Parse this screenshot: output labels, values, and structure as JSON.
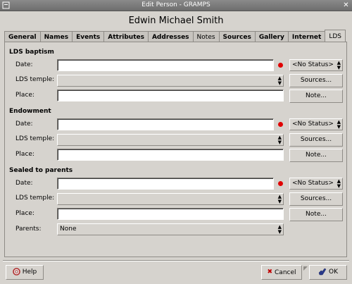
{
  "window": {
    "title": "Edit Person - GRAMPS"
  },
  "person_name": "Edwin Michael Smith",
  "tabs": [
    "General",
    "Names",
    "Events",
    "Attributes",
    "Addresses",
    "Notes",
    "Sources",
    "Gallery",
    "Internet",
    "LDS"
  ],
  "sections": [
    {
      "title": "LDS baptism",
      "date_label": "Date:",
      "temple_label": "LDS temple:",
      "place_label": "Place:",
      "date_value": "",
      "temple_value": "",
      "place_value": "",
      "status": "<No Status>",
      "sources_label": "Sources...",
      "note_label": "Note..."
    },
    {
      "title": "Endowment",
      "date_label": "Date:",
      "temple_label": "LDS temple:",
      "place_label": "Place:",
      "date_value": "",
      "temple_value": "",
      "place_value": "",
      "status": "<No Status>",
      "sources_label": "Sources...",
      "note_label": "Note..."
    },
    {
      "title": "Sealed to parents",
      "date_label": "Date:",
      "temple_label": "LDS temple:",
      "place_label": "Place:",
      "date_value": "",
      "temple_value": "",
      "place_value": "",
      "status": "<No Status>",
      "sources_label": "Sources...",
      "note_label": "Note..."
    }
  ],
  "parents": {
    "label": "Parents:",
    "value": "None"
  },
  "footer": {
    "help_label": "Help",
    "cancel_label": "Cancel",
    "ok_label": "OK"
  },
  "colors": {
    "required_dot": "#e00000",
    "background": "#d6d3ce",
    "titlebar": "#7a7a7a"
  }
}
